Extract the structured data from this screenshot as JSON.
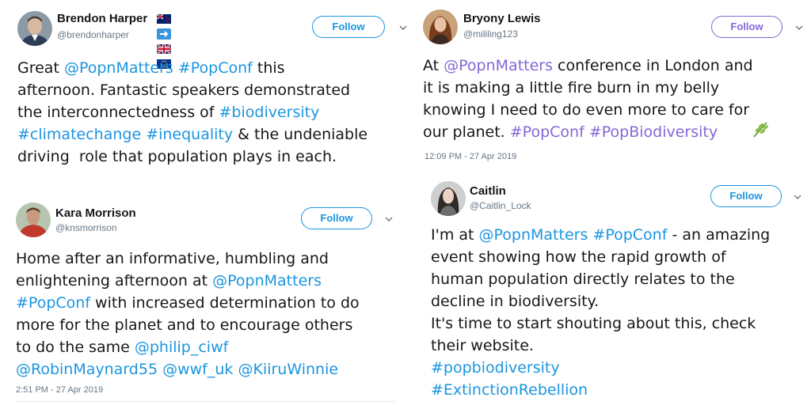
{
  "colors": {
    "link_blue": "#1b95e0",
    "link_purple": "#8467d7",
    "follow_border": "#1b95e0"
  },
  "tweets": [
    {
      "name": "Brendon Harper",
      "handle": "@brendonharper",
      "follow_label": "Follow",
      "flags": [
        "new-zealand-flag-icon",
        "arrow-right-icon",
        "uk-flag-icon",
        "eu-flag-icon"
      ],
      "body": [
        [
          [
            "t",
            "Great "
          ],
          [
            "l",
            "@PopnMatters"
          ],
          [
            "t",
            " "
          ],
          [
            "l",
            "#PopConf"
          ],
          [
            "t",
            " this"
          ]
        ],
        [
          [
            "t",
            "afternoon. Fantastic speakers demonstrated"
          ]
        ],
        [
          [
            "t",
            "the interconnectedness of "
          ],
          [
            "l",
            "#biodiversity"
          ]
        ],
        [
          [
            "l",
            "#climatechange"
          ],
          [
            "t",
            " "
          ],
          [
            "l",
            "#inequality"
          ],
          [
            "t",
            " & the undeniable"
          ]
        ],
        [
          [
            "t",
            "driving  role that population plays in each."
          ]
        ]
      ]
    },
    {
      "name": "Kara Morrison",
      "handle": "@knsmorrison",
      "follow_label": "Follow",
      "body": [
        [
          [
            "t",
            "Home after an informative, humbling and"
          ]
        ],
        [
          [
            "t",
            "enlightening afternoon at "
          ],
          [
            "l",
            "@PopnMatters"
          ]
        ],
        [
          [
            "l",
            "#PopConf"
          ],
          [
            "t",
            " with increased determination to do"
          ]
        ],
        [
          [
            "t",
            "more for the planet and to encourage others"
          ]
        ],
        [
          [
            "t",
            "to do the same "
          ],
          [
            "l",
            "@philip_ciwf"
          ]
        ],
        [
          [
            "l",
            "@RobinMaynard55"
          ],
          [
            "t",
            " "
          ],
          [
            "l",
            "@wwf_uk"
          ],
          [
            "t",
            " "
          ],
          [
            "l",
            "@KiiruWinnie"
          ]
        ]
      ],
      "time": "2:51 PM - 27 Apr 2019"
    },
    {
      "name": "Bryony Lewis",
      "handle": "@mililing123",
      "follow_label": "Follow",
      "body": [
        [
          [
            "l",
            "@PopnMatters"
          ],
          [
            "t",
            " conference in London and"
          ]
        ],
        [
          [
            "t",
            "it is making a little fire burn in my belly"
          ]
        ],
        [
          [
            "t",
            "knowing I need to do even more to care for"
          ]
        ],
        [
          [
            "t",
            "our planet. "
          ],
          [
            "l",
            "#PopConf"
          ],
          [
            "t",
            " "
          ],
          [
            "l",
            "#PopBiodiversity"
          ]
        ]
      ],
      "body_prefix": "At ",
      "emoji": "herb-icon",
      "time": "12:09 PM - 27 Apr 2019"
    },
    {
      "name": "Caitlin",
      "handle": "@Caitlin_Lock",
      "follow_label": "Follow",
      "body": [
        [
          [
            "t",
            "I'm at "
          ],
          [
            "l",
            "@PopnMatters"
          ],
          [
            "t",
            " "
          ],
          [
            "l",
            "#PopConf"
          ],
          [
            "t",
            " - an amazing"
          ]
        ],
        [
          [
            "t",
            "event showing how the rapid growth of"
          ]
        ],
        [
          [
            "t",
            "human population directly relates to the"
          ]
        ],
        [
          [
            "t",
            "decline in biodiversity."
          ]
        ],
        [
          [
            "t",
            "It's time to start shouting about this, check"
          ]
        ],
        [
          [
            "t",
            "their website."
          ]
        ],
        [
          [
            "l",
            "#popbiodiversity"
          ]
        ],
        [
          [
            "l",
            "#ExtinctionRebellion"
          ]
        ]
      ]
    }
  ]
}
